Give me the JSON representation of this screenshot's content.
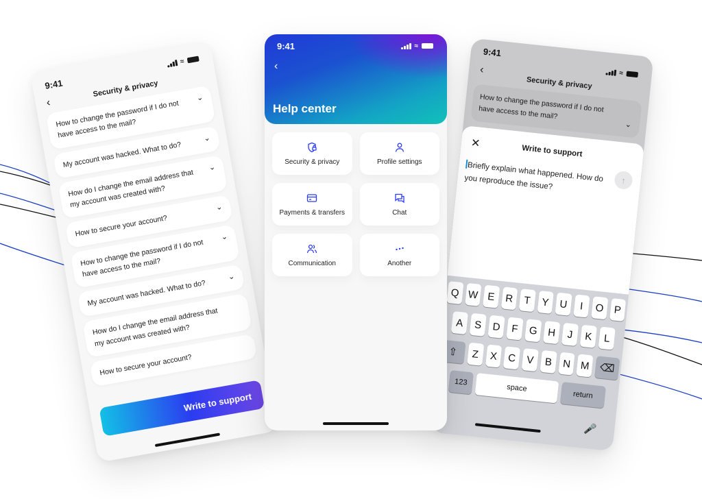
{
  "status_bar": {
    "time": "9:41"
  },
  "accent_color": "#2b3cf0",
  "left_screen": {
    "title": "Security & privacy",
    "back_icon": "chevron-left-icon",
    "faq": [
      {
        "question": "How to change the password if I do not have access to the mail?"
      },
      {
        "question": "My account was hacked. What to do?"
      },
      {
        "question": "How do I change the email address that my account was created with?"
      },
      {
        "question": "How to secure your account?"
      },
      {
        "question": "How to change the password if I do not have access to the mail?"
      },
      {
        "question": "My account was hacked. What to do?"
      },
      {
        "question": "How do I change the email address that my account was created with?"
      },
      {
        "question": "How to secure your account?"
      }
    ],
    "cta_label": "Write to support"
  },
  "center_screen": {
    "title": "Help center",
    "tiles": [
      {
        "label": "Security & privacy",
        "icon": "shield-lock-icon"
      },
      {
        "label": "Profile settings",
        "icon": "user-icon"
      },
      {
        "label": "Payments & transfers",
        "icon": "credit-card-icon"
      },
      {
        "label": "Chat",
        "icon": "chat-bubbles-icon"
      },
      {
        "label": "Communication",
        "icon": "users-icon"
      },
      {
        "label": "Another",
        "icon": "more-dots-icon"
      }
    ]
  },
  "right_screen": {
    "title": "Security & privacy",
    "faq_question": "How to change the password if I do not have access to the mail?",
    "sheet": {
      "title": "Write to support",
      "input_text": "Briefly explain what happened. How do you reproduce the issue?"
    },
    "keyboard": {
      "row1": [
        "Q",
        "W",
        "E",
        "R",
        "T",
        "Y",
        "U",
        "I",
        "O",
        "P"
      ],
      "row2": [
        "A",
        "S",
        "D",
        "F",
        "G",
        "H",
        "J",
        "K",
        "L"
      ],
      "row3": [
        "Z",
        "X",
        "C",
        "V",
        "B",
        "N",
        "M"
      ],
      "space_label": "space",
      "return_label": "return"
    }
  }
}
